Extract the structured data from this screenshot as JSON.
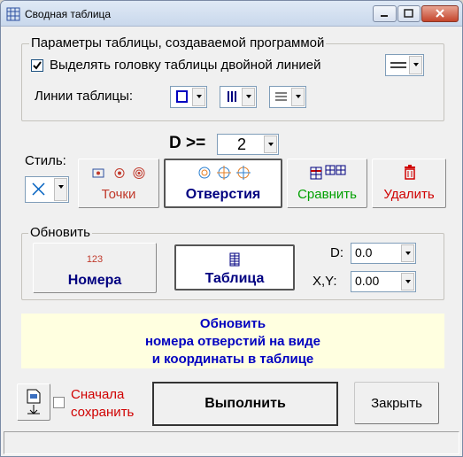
{
  "window": {
    "title": "Сводная таблица"
  },
  "params": {
    "legend": "Параметры таблицы, создаваемой программой",
    "double_line_checked": true,
    "double_line_label": "Выделять головку таблицы двойной линией",
    "lines_label": "Линии таблицы:"
  },
  "d_filter": {
    "label": "D >=",
    "value": "2"
  },
  "style": {
    "label": "Стиль:"
  },
  "tools": {
    "points": "Точки",
    "holes": "Отверстия",
    "compare": "Сравнить",
    "delete": "Удалить"
  },
  "update": {
    "legend": "Обновить",
    "numbers_caption": "123",
    "numbers_label": "Номера",
    "table_label": "Таблица",
    "d_label": "D:",
    "d_value": "0.0",
    "xy_label": "X,Y:",
    "xy_value": "0.00"
  },
  "info": {
    "line1": "Обновить",
    "line2": "номера отверстий на виде",
    "line3": "и координаты в таблице"
  },
  "footer": {
    "save_first_line1": "Сначала",
    "save_first_line2": "сохранить",
    "save_first_checked": false,
    "execute": "Выполнить",
    "close": "Закрыть"
  },
  "colors": {
    "info_bg": "#ffffe0",
    "info_text": "#0000c0",
    "points_red": "#c0392b",
    "compare_green": "#00a000",
    "delete_red": "#d00000",
    "header_blue": "#000080"
  }
}
